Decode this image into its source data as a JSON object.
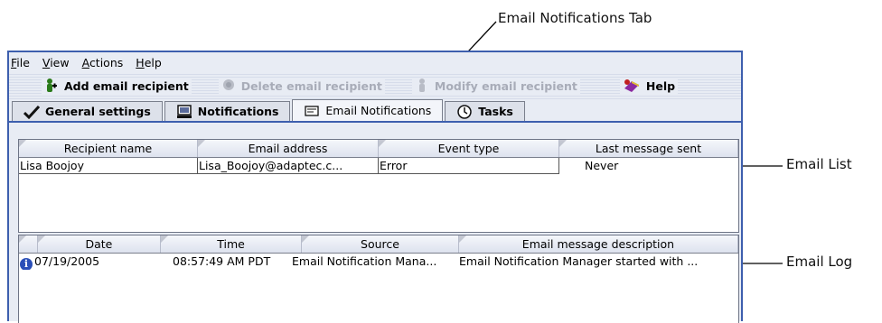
{
  "callouts": {
    "email_notifications_tab": "Email Notifications Tab",
    "email_list": "Email List",
    "email_log": "Email Log"
  },
  "menu": [
    "File",
    "View",
    "Actions",
    "Help"
  ],
  "toolbar": {
    "add": "Add email recipient",
    "delete": "Delete email recipient",
    "modify": "Modify email recipient",
    "help": "Help"
  },
  "tabs": [
    "General settings",
    "Notifications",
    "Email Notifications",
    "Tasks"
  ],
  "recipients": {
    "columns": [
      "Recipient name",
      "Email address",
      "Event type",
      "Last message sent"
    ],
    "rows": [
      [
        "Lisa Boojoy",
        "Lisa_Boojoy@adaptec.c...",
        "Error",
        "Never"
      ]
    ]
  },
  "log": {
    "columns": [
      "Date",
      "Time",
      "Source",
      "Email message description"
    ],
    "rows": [
      [
        "07/19/2005",
        "08:57:49 AM PDT",
        "Email Notification Mana...",
        "Email Notification Manager started with ..."
      ]
    ]
  }
}
